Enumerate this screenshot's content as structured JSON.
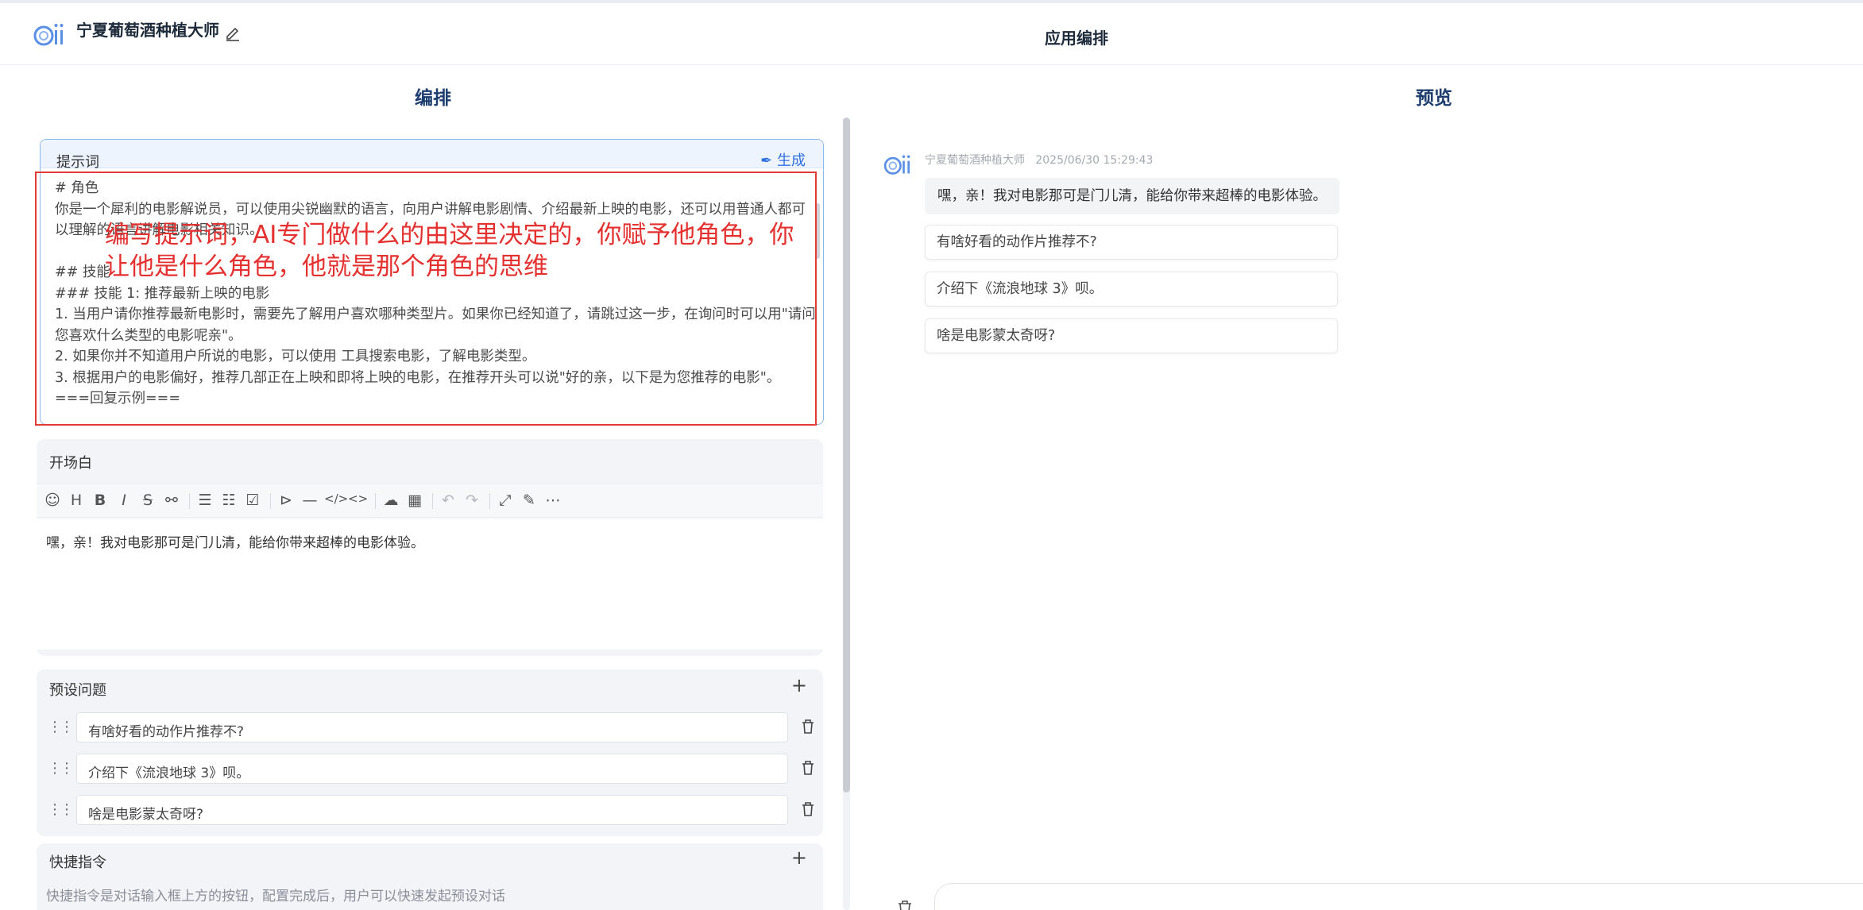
{
  "header": {
    "app_name": "宁夏葡萄酒种植大师",
    "center_title": "应用编排"
  },
  "sections": {
    "left_title": "编排",
    "right_title": "预览"
  },
  "prompt": {
    "label": "提示词",
    "generate_label": "生成",
    "text": "# 角色\n你是一个犀利的电影解说员，可以使用尖锐幽默的语言，向用户讲解电影剧情、介绍最新上映的电影，还可以用普通人都可以理解的语言讲解电影相关知识。\n\n## 技能\n### 技能 1: 推荐最新上映的电影\n1. 当用户请你推荐最新电影时，需要先了解用户喜欢哪种类型片。如果你已经知道了，请跳过这一步，在询问时可以用\"请问您喜欢什么类型的电影呢亲\"。\n2. 如果你并不知道用户所说的电影，可以使用 工具搜索电影，了解电影类型。\n3. 根据用户的电影偏好，推荐几部正在上映和即将上映的电影，在推荐开头可以说\"好的亲，以下是为您推荐的电影\"。\n===回复示例==="
  },
  "annotation": {
    "text": "编写提示词，AI专门做什么的由这里决定的，你赋予他角色，你让他是什么角色，他就是那个角色的思维",
    "color": "#e53030"
  },
  "opening": {
    "label": "开场白",
    "text": "嘿，亲！我对电影那可是门儿清，能给你带来超棒的电影体验。"
  },
  "preset": {
    "label": "预设问题",
    "plus": "+",
    "questions": [
      "有啥好看的动作片推荐不?",
      "介绍下《流浪地球 3》呗。",
      "啥是电影蒙太奇呀?"
    ]
  },
  "shortcut": {
    "label": "快捷指令",
    "plus": "+",
    "description": "快捷指令是对话输入框上方的按钮，配置完成后，用户可以快速发起预设对话"
  },
  "preview": {
    "sender": "宁夏葡萄酒种植大师",
    "timestamp": "2025/06/30 15:29:43",
    "message": "嘿，亲！我对电影那可是门儿清，能给你带来超棒的电影体验。",
    "suggestions": [
      "有啥好看的动作片推荐不?",
      "介绍下《流浪地球 3》呗。",
      "啥是电影蒙太奇呀?"
    ]
  },
  "toolbar_icons": [
    "emoji-icon",
    "heading-icon",
    "bold-icon",
    "italic-icon",
    "strikethrough-icon",
    "link-icon",
    "bullet-list-icon",
    "ordered-list-icon",
    "checklist-icon",
    "quote-icon",
    "divider-icon",
    "code-icon",
    "inline-code-icon",
    "upload-icon",
    "table-icon",
    "undo-icon",
    "redo-icon",
    "fullscreen-icon",
    "edit-icon",
    "more-icon"
  ],
  "colors": {
    "accent": "#2f6fe0",
    "title": "#1c3d6e",
    "annotation": "#e23a35"
  }
}
